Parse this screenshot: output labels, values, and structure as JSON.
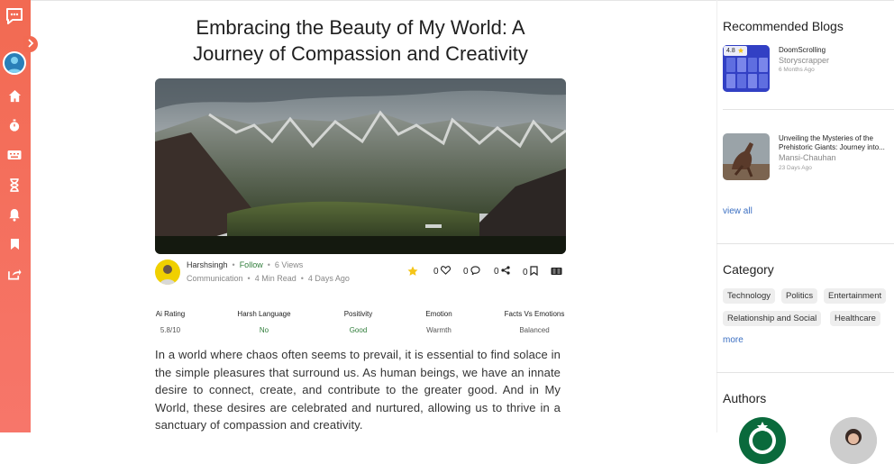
{
  "article": {
    "title_line1": "Embracing the Beauty of My World: A",
    "title_line2": "Journey of Compassion and Creativity",
    "author": "Harshsingh",
    "follow": "Follow",
    "views": "6 Views",
    "category": "Communication",
    "read_time": "4 Min Read",
    "posted": "4 Days Ago",
    "likes": "0",
    "comments": "0",
    "shares": "0",
    "bookmarks": "0",
    "stats": [
      {
        "label": "Ai Rating",
        "value": "5.8/10",
        "highlight": false
      },
      {
        "label": "Harsh Language",
        "value": "No",
        "highlight": true
      },
      {
        "label": "Positivity",
        "value": "Good",
        "highlight": true
      },
      {
        "label": "Emotion",
        "value": "Warmth",
        "highlight": false
      },
      {
        "label": "Facts Vs Emotions",
        "value": "Balanced",
        "highlight": false
      }
    ],
    "body": "In a world where chaos often seems to prevail, it is essential to find solace in the simple pleasures that surround us. As human beings, we have an innate desire to connect, create, and contribute to the greater good. And in My World, these desires are celebrated and nurtured, allowing us to thrive in a sanctuary of compassion and creativity."
  },
  "sidebar": {
    "recommended_title": "Recommended Blogs",
    "blogs": [
      {
        "title": "DoomScrolling",
        "author": "Storyscrapper",
        "time": "6 Months Ago",
        "badge": "4.8"
      },
      {
        "title": "Unveiling the Mysteries of the Prehistoric Giants: Journey into...",
        "author": "Mansi-Chauhan",
        "time": "23 Days Ago"
      }
    ],
    "view_all": "view all",
    "category_title": "Category",
    "categories": [
      "Technology",
      "Politics",
      "Entertainment",
      "Relationship and Social",
      "Healthcare"
    ],
    "more": "more",
    "authors_title": "Authors"
  },
  "colors": {
    "accent": "#f26a52",
    "follow_green": "#2f7d3a",
    "link_blue": "#3b6fc2",
    "star": "#f5c518"
  },
  "icons": [
    "chat-logo-icon",
    "chevron-right-icon",
    "home-icon",
    "stopwatch-icon",
    "keyboard-icon",
    "hourglass-icon",
    "bell-icon",
    "bookmark-icon",
    "share-box-icon",
    "star-icon",
    "heart-icon",
    "comment-icon",
    "share-icon",
    "bookmark-outline-icon",
    "reader-icon"
  ]
}
